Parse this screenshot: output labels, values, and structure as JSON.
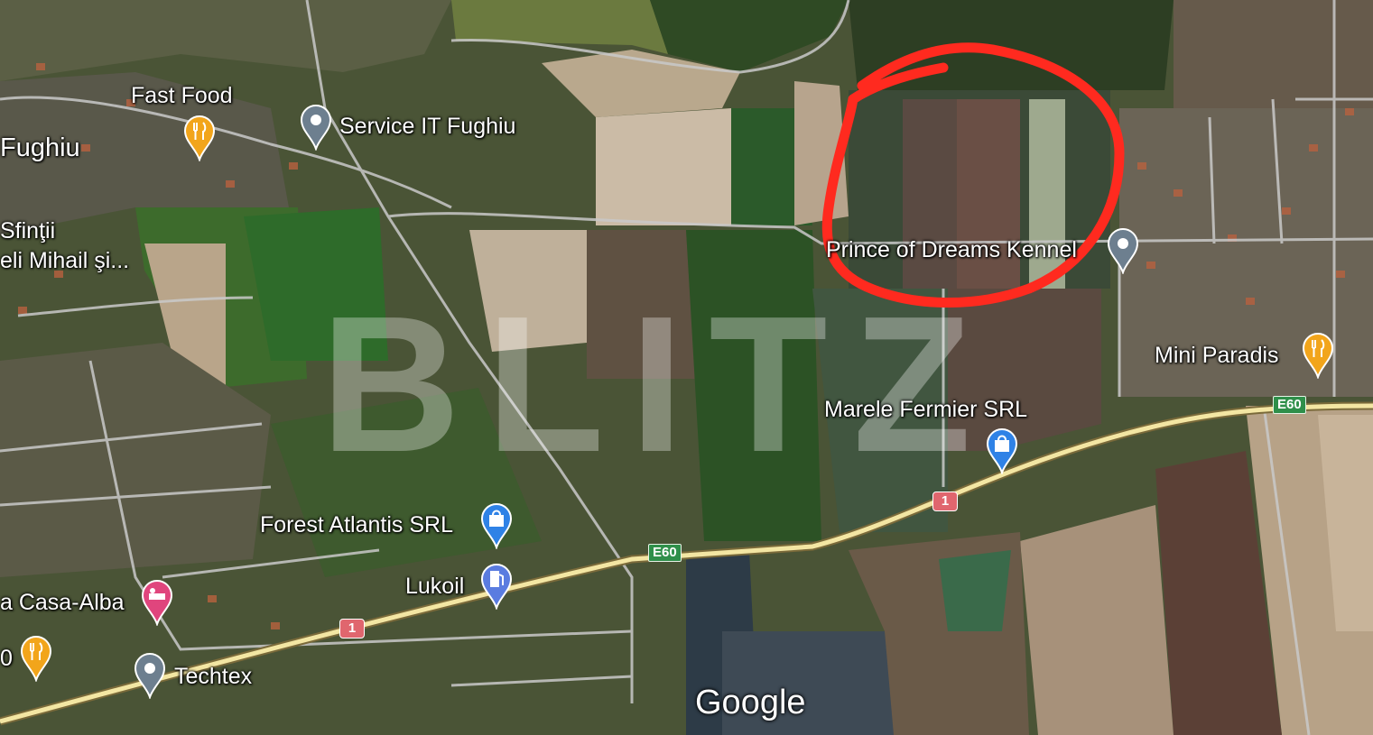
{
  "watermark": "BLITZ",
  "attribution": "Google",
  "colors": {
    "highlight": "#ff2a1f",
    "pin_grey": "#6d7f8f",
    "pin_food": "#f2a51b",
    "pin_shop": "#2f82e6",
    "pin_fuel": "#5a7ce0",
    "pin_hotel": "#e0457d",
    "road": "#f3e6a3"
  },
  "places": [
    {
      "name": "Fast Food",
      "icon": "restaurant-icon"
    },
    {
      "name": "Service IT Fughiu",
      "icon": "location-pin-icon"
    },
    {
      "name": "Fughiu",
      "icon": ""
    },
    {
      "name": "Sfinţii",
      "icon": ""
    },
    {
      "name": "eli Mihail şi...",
      "icon": ""
    },
    {
      "name": "Prince of Dreams Kennel",
      "icon": "location-pin-icon"
    },
    {
      "name": "Mini Paradis",
      "icon": "restaurant-icon"
    },
    {
      "name": "Marele Fermier SRL",
      "icon": "shopping-bag-icon"
    },
    {
      "name": "Forest Atlantis SRL",
      "icon": "shopping-bag-icon"
    },
    {
      "name": "Lukoil",
      "icon": "fuel-station-icon"
    },
    {
      "name": "a Casa-Alba",
      "icon": "hotel-icon"
    },
    {
      "name": "Techtex",
      "icon": "location-pin-icon"
    },
    {
      "name": "0",
      "icon": "restaurant-icon"
    }
  ],
  "road_shields": {
    "e60_a": "E60",
    "e60_b": "E60",
    "route_a": "1",
    "route_b": "1"
  }
}
